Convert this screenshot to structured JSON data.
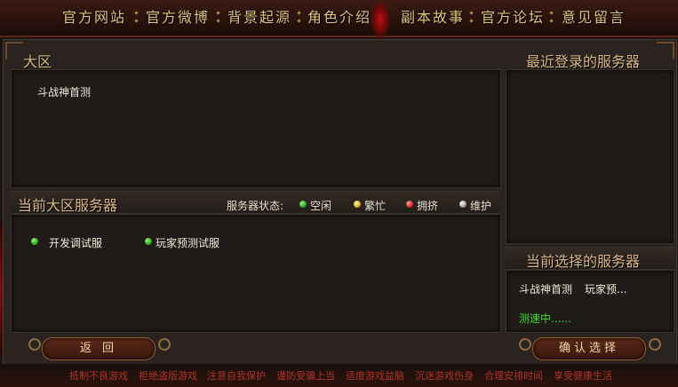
{
  "nav": {
    "items": [
      "官方网站",
      "官方微博",
      "背景起源",
      "角色介绍",
      "副本故事",
      "官方论坛",
      "意见留言"
    ]
  },
  "region": {
    "title": "大区",
    "items": [
      "斗战神首测"
    ]
  },
  "recent": {
    "title": "最近登录的服务器"
  },
  "current_region": {
    "title": "当前大区服务器",
    "status_label": "服务器状态:",
    "legend": [
      {
        "label": "空闲",
        "color": "green"
      },
      {
        "label": "繁忙",
        "color": "yellow"
      },
      {
        "label": "拥挤",
        "color": "red"
      },
      {
        "label": "维护",
        "color": "grey"
      }
    ],
    "servers": [
      {
        "name": "开发调试服",
        "status": "green"
      },
      {
        "name": "玩家预测试服",
        "status": "green"
      }
    ]
  },
  "selected": {
    "title": "当前选择的服务器",
    "region": "斗战神首测",
    "server": "玩家预...",
    "status": "测速中......"
  },
  "buttons": {
    "back": "返 回",
    "confirm": "确认选择"
  },
  "footer": [
    "抵制不良游戏",
    "拒绝盗版游戏",
    "注意自我保护",
    "谨防受骗上当",
    "适度游戏益脑",
    "沉迷游戏伤身",
    "合理安排时间",
    "享受健康生活"
  ],
  "colors": {
    "accent": "#e3c27a",
    "status_text": "#3edc2a",
    "footer_text": "#b0342a"
  }
}
